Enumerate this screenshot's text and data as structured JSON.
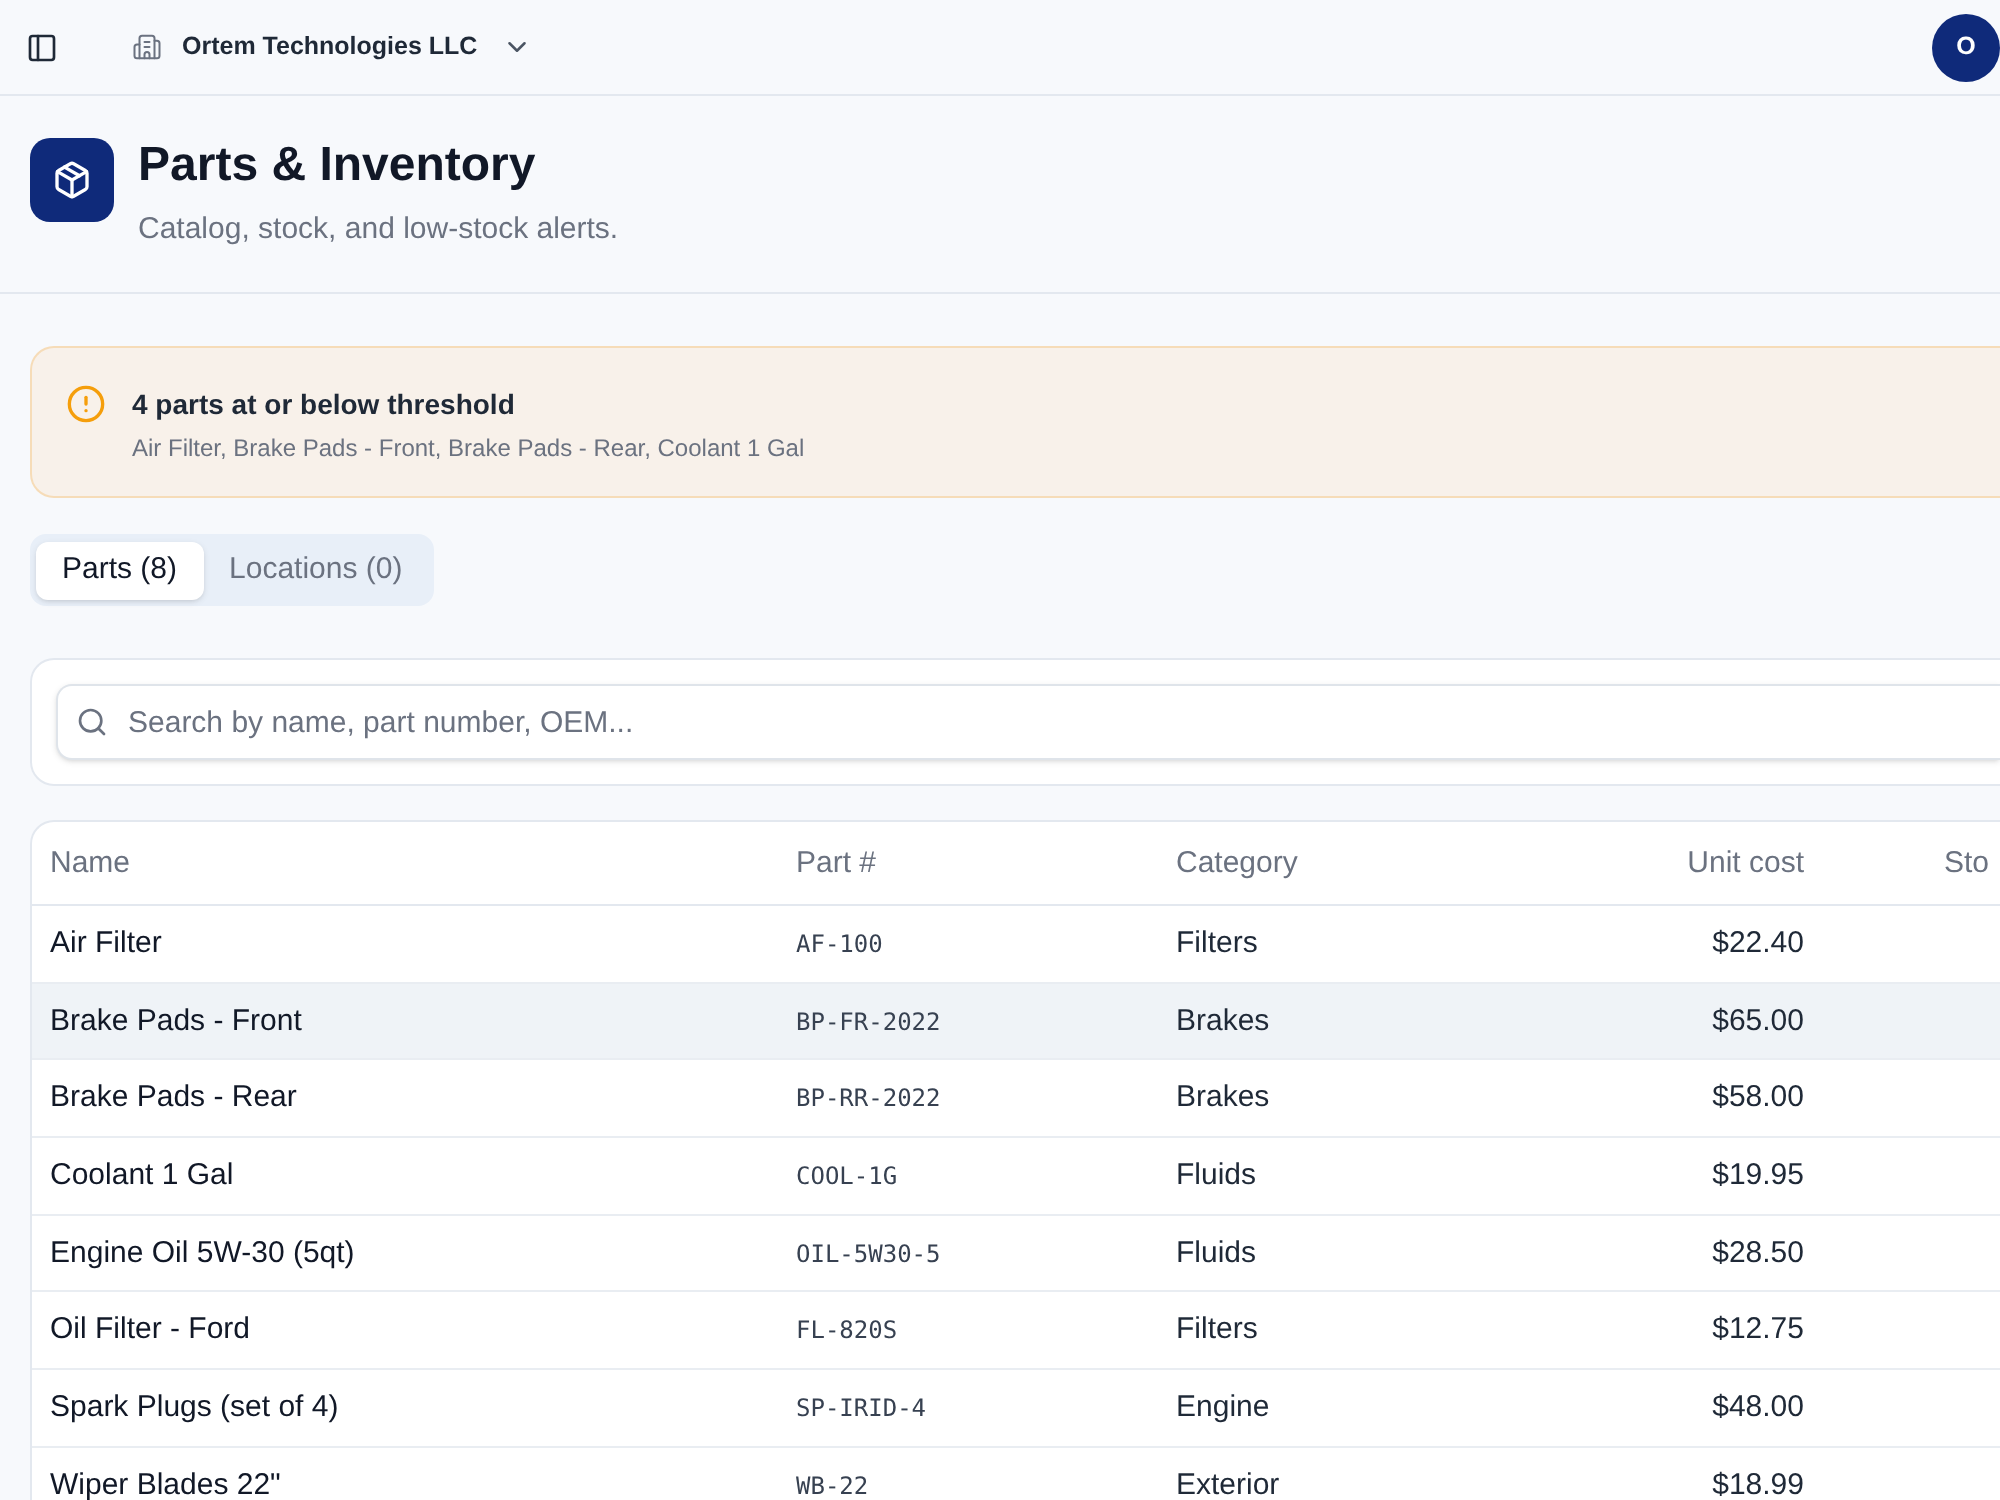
{
  "top_bar": {
    "organization": "Ortem Technologies LLC",
    "avatar_initial": "O"
  },
  "header": {
    "title": "Parts & Inventory",
    "subtitle": "Catalog, stock, and low-stock alerts."
  },
  "alert": {
    "title": "4 parts at or below threshold",
    "items": "Air Filter, Brake Pads - Front, Brake Pads - Rear, Coolant 1 Gal"
  },
  "tabs": [
    {
      "label": "Parts (8)",
      "selected": true
    },
    {
      "label": "Locations (0)",
      "selected": false
    }
  ],
  "search": {
    "placeholder": "Search by name, part number, OEM..."
  },
  "table": {
    "columns": [
      "Name",
      "Part #",
      "Category",
      "Unit cost",
      "Sto"
    ],
    "rows": [
      {
        "name": "Air Filter",
        "part_number": "AF-100",
        "category": "Filters",
        "unit_cost": "$22.40",
        "highlighted": false
      },
      {
        "name": "Brake Pads - Front",
        "part_number": "BP-FR-2022",
        "category": "Brakes",
        "unit_cost": "$65.00",
        "highlighted": true
      },
      {
        "name": "Brake Pads - Rear",
        "part_number": "BP-RR-2022",
        "category": "Brakes",
        "unit_cost": "$58.00",
        "highlighted": false
      },
      {
        "name": "Coolant 1 Gal",
        "part_number": "COOL-1G",
        "category": "Fluids",
        "unit_cost": "$19.95",
        "highlighted": false
      },
      {
        "name": "Engine Oil 5W-30 (5qt)",
        "part_number": "OIL-5W30-5",
        "category": "Fluids",
        "unit_cost": "$28.50",
        "highlighted": false
      },
      {
        "name": "Oil Filter - Ford",
        "part_number": "FL-820S",
        "category": "Filters",
        "unit_cost": "$12.75",
        "highlighted": false
      },
      {
        "name": "Spark Plugs (set of 4)",
        "part_number": "SP-IRID-4",
        "category": "Engine",
        "unit_cost": "$48.00",
        "highlighted": false
      },
      {
        "name": "Wiper Blades 22\"",
        "part_number": "WB-22",
        "category": "Exterior",
        "unit_cost": "$18.99",
        "highlighted": false
      }
    ]
  }
}
